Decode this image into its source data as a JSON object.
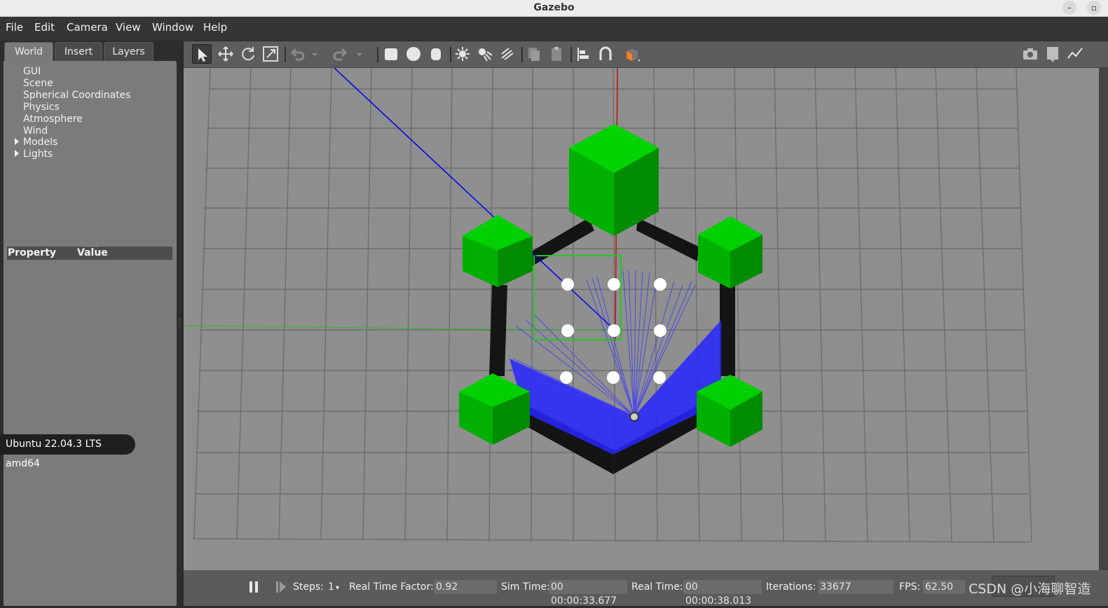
{
  "window": {
    "title": "Gazebo",
    "minimize_label": "–",
    "maximize_label": "▫"
  },
  "menu": [
    "File",
    "Edit",
    "Camera",
    "View",
    "Window",
    "Help"
  ],
  "tabs": [
    "World",
    "Insert",
    "Layers"
  ],
  "tree": [
    "GUI",
    "Scene",
    "Spherical Coordinates",
    "Physics",
    "Atmosphere",
    "Wind",
    "Models",
    "Lights"
  ],
  "splitter_dots": ".....",
  "properties": {
    "col1": "Property",
    "col2": "Value"
  },
  "os_toast": "Ubuntu 22.04.3 LTS amd64",
  "toolbar_icons": [
    "select-arrow-icon",
    "translate-icon",
    "rotate-icon",
    "scale-icon",
    "undo-icon",
    "undo-dropdown-icon",
    "redo-icon",
    "redo-dropdown-icon",
    "box-icon",
    "sphere-icon",
    "cylinder-icon",
    "point-light-icon",
    "spot-light-icon",
    "directional-light-icon",
    "copy-icon",
    "paste-icon",
    "align-icon",
    "snap-icon",
    "view-angle-icon",
    "screenshot-icon",
    "log-icon",
    "plot-icon"
  ],
  "status": {
    "steps_label": "Steps:",
    "steps_value": "1",
    "rtf_label": "Real Time Factor:",
    "rtf_value": "0.92",
    "sim_time_label": "Sim Time:",
    "sim_time_value": "00 00:00:33.677",
    "real_time_label": "Real Time:",
    "real_time_value": "00 00:00:38.013",
    "iterations_label": "Iterations:",
    "iterations_value": "33677",
    "fps_label": "FPS:",
    "fps_value": "62.50"
  },
  "watermark": "CSDN @小海聊智造",
  "colors": {
    "ground": "#8f8f8f",
    "grid": "#6e6e6e",
    "pillar": "#00c000",
    "wall": "#111111",
    "laser": "#0000ff",
    "target": "#ffffff"
  }
}
